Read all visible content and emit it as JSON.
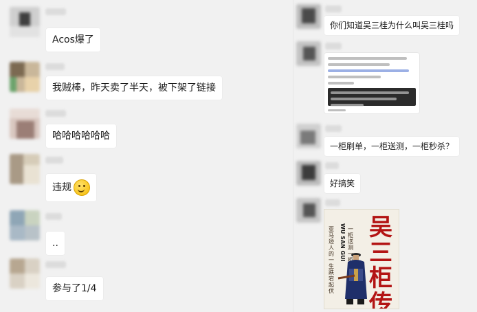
{
  "left_messages": [
    {
      "text": "Acos爆了"
    },
    {
      "text": "我贼棒，昨天卖了半天，被下架了链接"
    },
    {
      "text": "哈哈哈哈哈哈"
    },
    {
      "text": "违规",
      "emoji": "smile-emoji"
    },
    {
      "text": ".."
    },
    {
      "text": "参与了1/4"
    }
  ],
  "right_messages": [
    {
      "text": "你们知道吴三桂为什么叫吴三桂吗"
    },
    {
      "text": "一柜刷单，一柜送测，一柜秒杀？"
    },
    {
      "text": "好搞笑"
    }
  ],
  "book_cover": {
    "title": "吴三柜传",
    "pinyin": "WU SAN GUI",
    "slogan_1": "一柜送测 一柜刷 一柜秒杀",
    "slogan_2": "亚马逊人的 一生跌宕起伏"
  },
  "colors": {
    "background": "#f1f1f1",
    "bubble": "#ffffff",
    "book_title": "#b31414"
  }
}
